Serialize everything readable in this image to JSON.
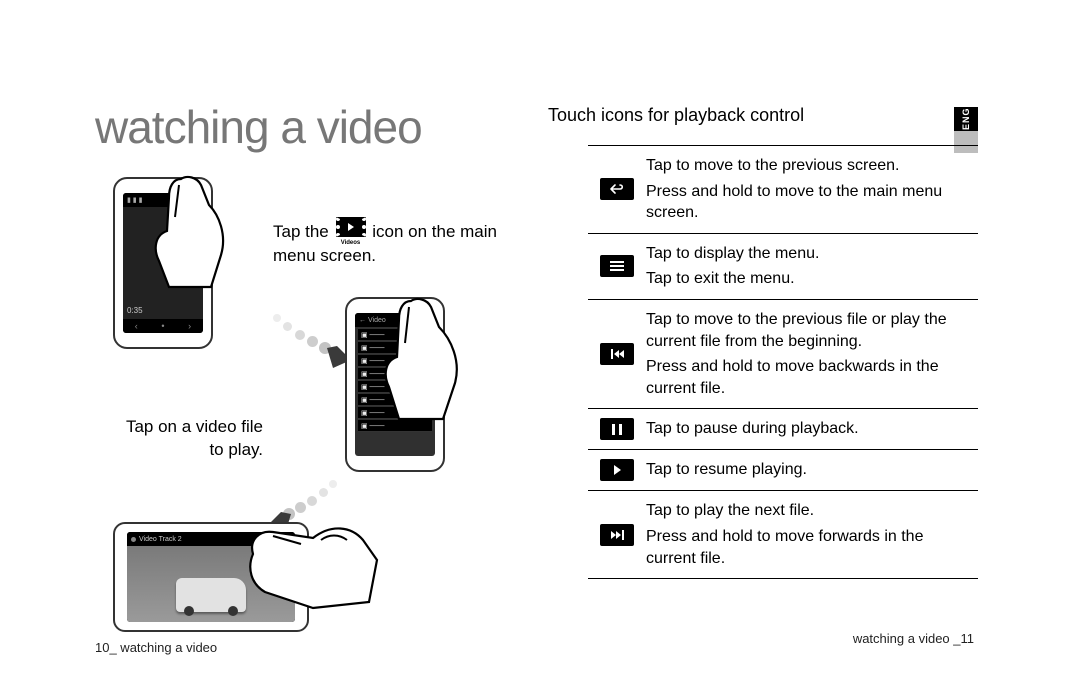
{
  "left": {
    "title": "watching a video",
    "step1_pre": "Tap the ",
    "step1_post": " icon on the main menu screen.",
    "videos_icon_label": "Videos",
    "step2": "Tap on a video file to play.",
    "device1_time": "0:35",
    "device1_bottom_prev": "‹",
    "device1_bottom_dot": "•",
    "device1_bottom_next": "›",
    "device2_header_back": "←",
    "device2_header_title": "Video",
    "device3_track": "Video Track 2",
    "footer": "10_ watching a video"
  },
  "right": {
    "lang_tab": "ENG",
    "title": "Touch icons for playback control",
    "rows": {
      "back": "Tap to move to the previous screen.\nPress and hold to move to the main menu screen.",
      "menu": "Tap to display the menu.\nTap to exit the menu.",
      "prev": "Tap to move to the previous file or play the current file from the beginning.\nPress and hold to move backwards in the current file.",
      "pause": "Tap to pause during playback.",
      "play": "Tap to resume playing.",
      "next": "Tap to play the next file.\nPress and hold to move forwards in the current file."
    },
    "footer": "watching a video _11"
  }
}
